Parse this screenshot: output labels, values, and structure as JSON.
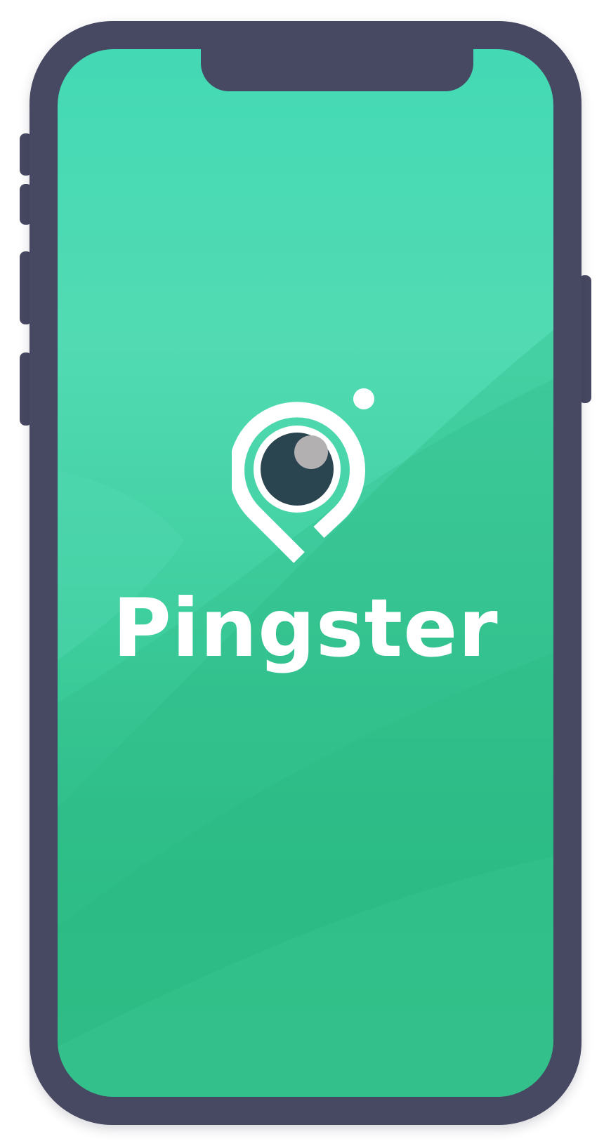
{
  "app": {
    "name": "Pingster"
  },
  "logo": {
    "icon": "map-pin-camera-icon"
  },
  "colors": {
    "device_frame": "#474862",
    "screen_top": "#43d9b4",
    "screen_bottom": "#2fc08a",
    "logo_white": "#ffffff",
    "lens_dark": "#2a4450",
    "lens_highlight": "#b3b0b2"
  }
}
